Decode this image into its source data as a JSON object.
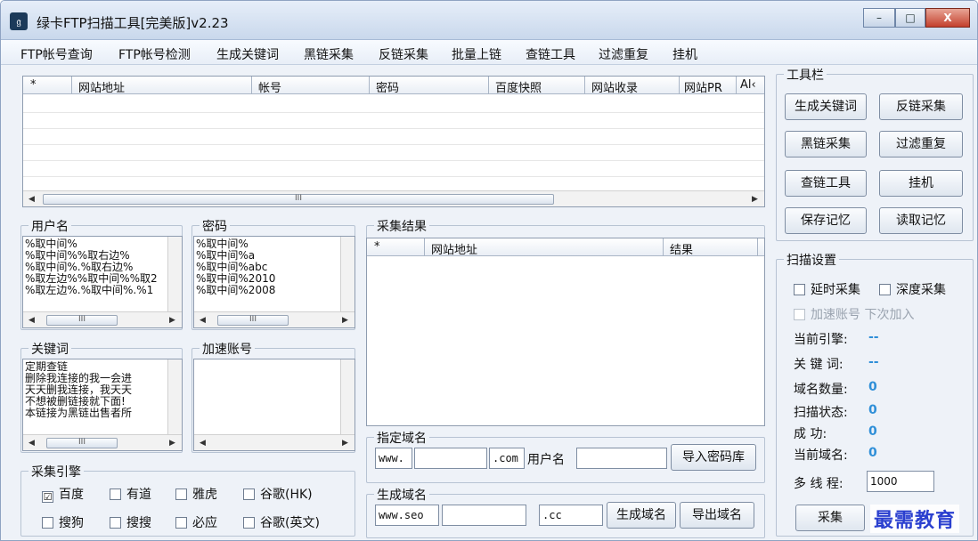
{
  "window": {
    "title": "绿卡FTP扫描工具[完美版]v2.23",
    "icon": "app-icon",
    "min": "–",
    "max": "□",
    "close": "X"
  },
  "menu": [
    "FTP帐号查询",
    "FTP帐号检测",
    "生成关键词",
    "黑链采集",
    "反链采集",
    "批量上链",
    "查链工具",
    "过滤重复",
    "挂机"
  ],
  "results_table": {
    "columns": [
      "*",
      "网站地址",
      "帐号",
      "密码",
      "百度快照",
      "网站收录",
      "网站PR",
      "Al‹"
    ],
    "scroll_label": "III"
  },
  "username": {
    "legend": "用户名",
    "lines": "%取中间%\n%取中间%%取右边%\n%取中间%.%取右边%\n%取左边%%取中间%%取2\n%取左边%.%取中间%.%1"
  },
  "password": {
    "legend": "密码",
    "lines": "%取中间%\n%取中间%a\n%取中间%abc\n%取中间%2010\n%取中间%2008"
  },
  "keywords": {
    "legend": "关键词",
    "lines": "定期查链\n删除我连接的我一会进\n天天删我连接，我天天\n不想被删链接就下面!\n本链接为黑链出售者所"
  },
  "speed_accounts": {
    "legend": "加速账号"
  },
  "collect_results": {
    "legend": "采集结果",
    "columns": [
      "*",
      "网站地址",
      "结果"
    ]
  },
  "engine": {
    "legend": "采集引擎",
    "options": [
      {
        "label": "百度",
        "checked": "☑"
      },
      {
        "label": "有道",
        "checked": ""
      },
      {
        "label": "雅虎",
        "checked": ""
      },
      {
        "label": "谷歌(HK)",
        "checked": ""
      },
      {
        "label": "搜狗",
        "checked": ""
      },
      {
        "label": "搜搜",
        "checked": ""
      },
      {
        "label": "必应",
        "checked": ""
      },
      {
        "label": "谷歌(英文)",
        "checked": ""
      }
    ]
  },
  "domain_spec": {
    "legend": "指定域名",
    "prefix": "www.",
    "suffix": ".com",
    "user_label": "用户名",
    "import_btn": "导入密码库"
  },
  "domain_gen": {
    "legend": "生成域名",
    "prefix": "www.seo",
    "suffix": ".cc",
    "gen_btn": "生成域名",
    "export_btn": "导出域名"
  },
  "toolbar": {
    "legend": "工具栏",
    "buttons": [
      "生成关键词",
      "反链采集",
      "黑链采集",
      "过滤重复",
      "查链工具",
      "挂机",
      "保存记忆",
      "读取记忆"
    ]
  },
  "scan": {
    "legend": "扫描设置",
    "delay": "延时采集",
    "depth": "深度采集",
    "accel": "加速账号 下次加入",
    "engine_label": "当前引擎:",
    "engine_val": "--",
    "keyword_label": "关 键 词:",
    "keyword_val": "--",
    "domain_count_label": "域名数量:",
    "domain_count_val": "0",
    "status_label": "扫描状态:",
    "status_val": "0",
    "success_label": "成      功:",
    "success_val": "0",
    "current_label": "当前域名:",
    "current_val": "0",
    "threads_label": "多 线 程:",
    "threads_val": "1000",
    "collect_btn": "采集"
  },
  "watermark": "最需教育"
}
